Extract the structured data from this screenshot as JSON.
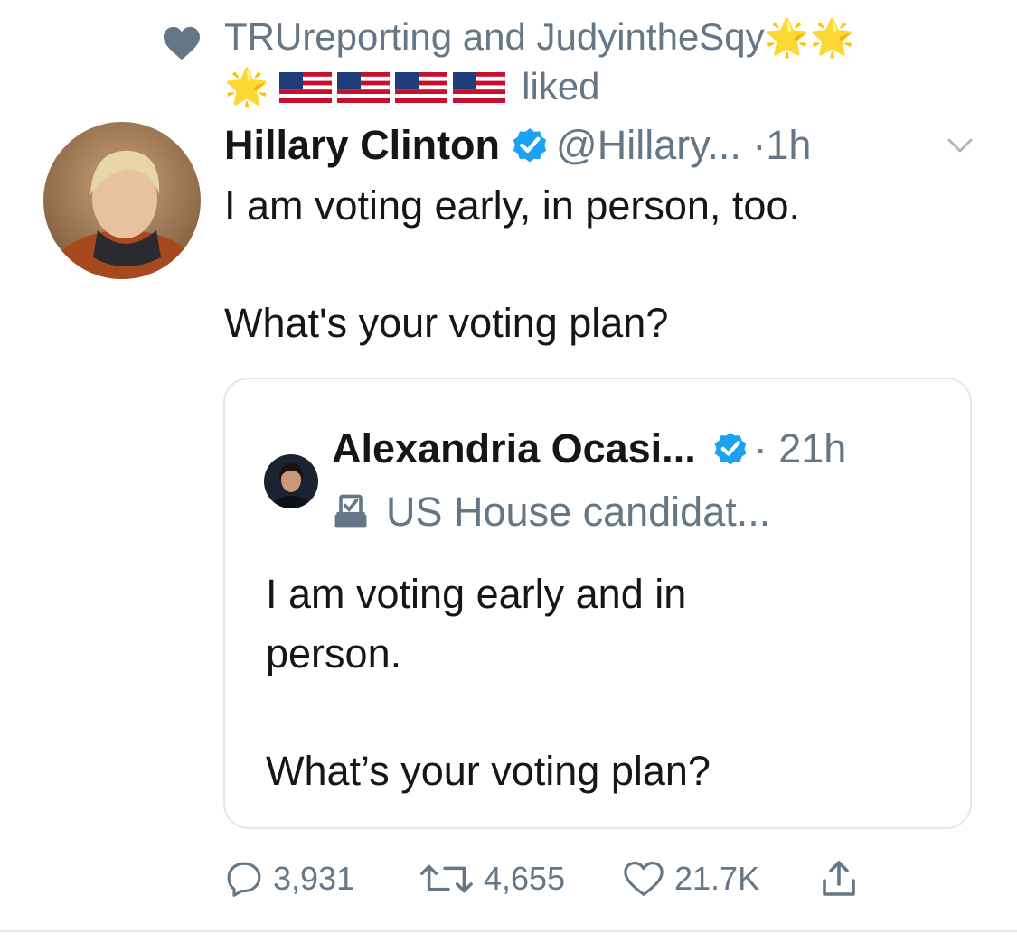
{
  "social_context": {
    "names": "TRUreporting and JudyintheSqy",
    "stars": [
      "🌟",
      "🌟",
      "🌟"
    ],
    "flags_count": 4,
    "action": "liked"
  },
  "tweet": {
    "name": "Hillary Clinton",
    "handle": "@Hillary...",
    "dot": "·",
    "time": "1h",
    "lines": [
      "I am voting early, in person, too.",
      "What's your voting plan?"
    ]
  },
  "quoted_tweet": {
    "name": "Alexandria Ocasi...",
    "dot": "·",
    "time": "21h",
    "label": "US House candidat...",
    "lines": [
      "I am voting early and in",
      "person.",
      "What’s your voting plan?"
    ]
  },
  "actions": {
    "replies": "3,931",
    "retweets": "4,655",
    "likes": "21.7K"
  },
  "icons": {
    "social": "heart-icon",
    "verified": "verified-badge-icon",
    "menu": "chevron-down-icon",
    "label": "ballot-box-icon",
    "reply": "reply-icon",
    "retweet": "retweet-icon",
    "like": "like-icon",
    "share": "share-icon"
  },
  "colors": {
    "verified": "#1da1f2",
    "secondary_text": "#657786",
    "border": "#e1e8ed"
  }
}
